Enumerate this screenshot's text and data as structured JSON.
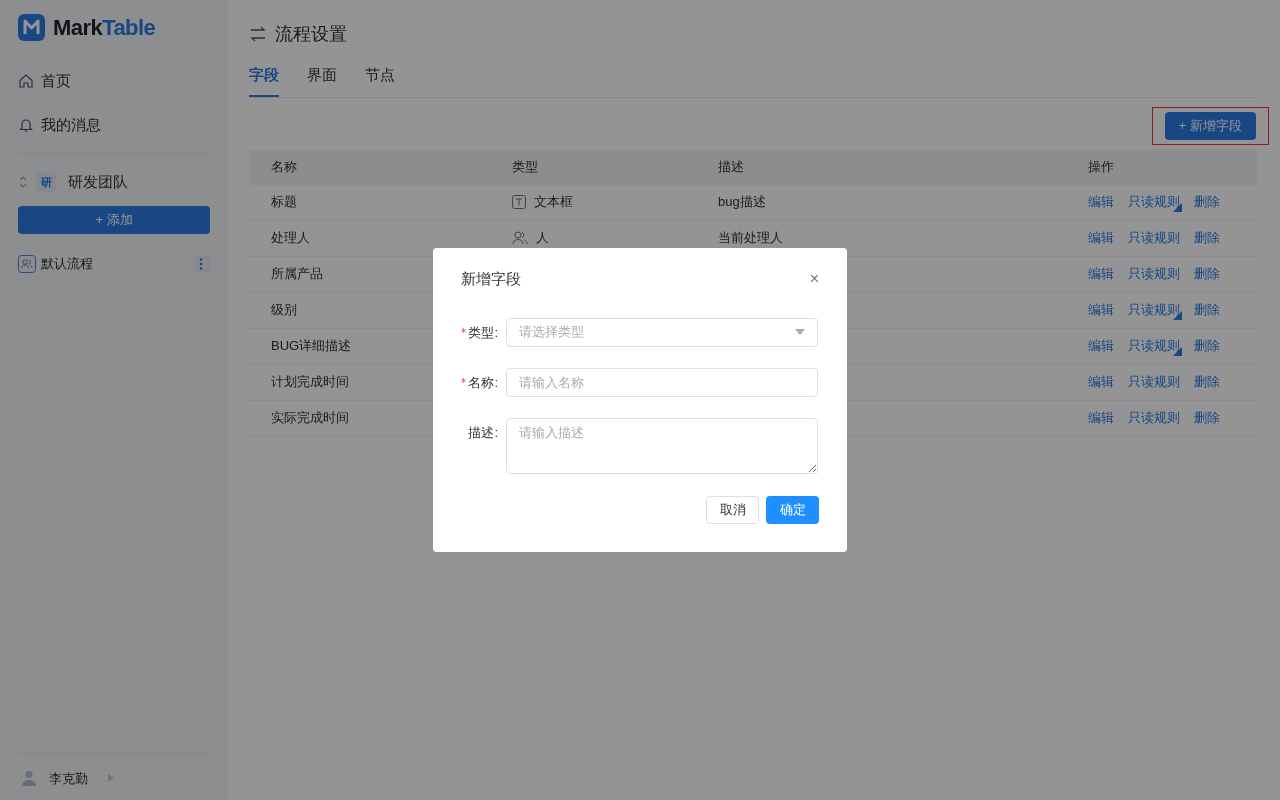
{
  "sidebar": {
    "logo": {
      "part1": "Mark",
      "part2": "Table"
    },
    "nav": [
      {
        "kind": "home",
        "label": "首页"
      },
      {
        "kind": "bell",
        "label": "我的消息"
      }
    ],
    "team": {
      "badge": "研",
      "name": "研发团队"
    },
    "add_button": "+ 添加",
    "flows": [
      {
        "label": "默认流程"
      }
    ],
    "user": {
      "name": "李克勤"
    }
  },
  "page": {
    "title": "流程设置",
    "tabs": [
      {
        "label": "字段",
        "selected": true
      },
      {
        "label": "界面",
        "selected": false
      },
      {
        "label": "节点",
        "selected": false
      }
    ],
    "add_button": {
      "label": "+ 新增字段",
      "highlighted": true
    },
    "table": {
      "columns": [
        "名称",
        "类型",
        "描述",
        "操作"
      ],
      "rows": [
        {
          "name": "标题",
          "type": {
            "kind": "text",
            "label": "文本框"
          },
          "description": "bug描述",
          "actions": {
            "edit": "编辑",
            "rule": "只读规则",
            "rule_set": true,
            "delete": "删除"
          }
        },
        {
          "name": "处理人",
          "type": {
            "kind": "person",
            "label": "人"
          },
          "description": "当前处理人",
          "actions": {
            "edit": "编辑",
            "rule": "只读规则",
            "rule_set": false,
            "delete": "删除"
          }
        },
        {
          "name": "所属产品",
          "actions": {
            "edit": "编辑",
            "rule": "只读规则",
            "rule_set": false,
            "delete": "删除"
          }
        },
        {
          "name": "级别",
          "actions": {
            "edit": "编辑",
            "rule": "只读规则",
            "rule_set": true,
            "delete": "删除"
          }
        },
        {
          "name": "BUG详细描述",
          "actions": {
            "edit": "编辑",
            "rule": "只读规则",
            "rule_set": true,
            "delete": "删除"
          }
        },
        {
          "name": "计划完成时间",
          "actions": {
            "edit": "编辑",
            "rule": "只读规则",
            "rule_set": false,
            "delete": "删除"
          }
        },
        {
          "name": "实际完成时间",
          "actions": {
            "edit": "编辑",
            "rule": "只读规则",
            "rule_set": false,
            "delete": "删除"
          }
        }
      ]
    }
  },
  "dialog": {
    "title": "新增字段",
    "close": "×",
    "fields": [
      {
        "kind": "select",
        "label": "类型:",
        "required": true,
        "placeholder": "请选择类型"
      },
      {
        "kind": "input",
        "label": "名称:",
        "required": true,
        "placeholder": "请输入名称"
      },
      {
        "kind": "textarea",
        "label": "描述:",
        "required": false,
        "placeholder": "请输入描述"
      }
    ],
    "buttons": [
      {
        "label": "取消",
        "kind": "secondary"
      },
      {
        "label": "确定",
        "kind": "primary"
      }
    ]
  }
}
